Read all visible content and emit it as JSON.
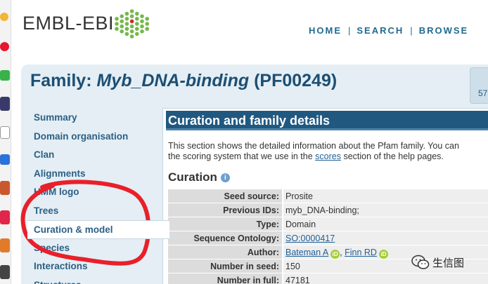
{
  "header": {
    "logo_text": "EMBL-EBI",
    "nav": [
      {
        "label": "HOME"
      },
      {
        "label": "SEARCH"
      },
      {
        "label": "BROWSE"
      }
    ],
    "separator": "|"
  },
  "page": {
    "title_prefix": "Family: ",
    "title_name": "Myb_DNA-binding",
    "title_suffix": " (PF00249)",
    "corner_number": "57"
  },
  "sidebar": {
    "items": [
      {
        "label": "Summary"
      },
      {
        "label": "Domain organisation"
      },
      {
        "label": "Clan"
      },
      {
        "label": "Alignments"
      },
      {
        "label": "HMM logo"
      },
      {
        "label": "Trees"
      },
      {
        "label": "Curation & model"
      },
      {
        "label": "Species"
      },
      {
        "label": "Interactions"
      },
      {
        "label": "Structures"
      }
    ],
    "active_index": 6
  },
  "content": {
    "heading": "Curation and family details",
    "intro_line1": "This section shows the detailed information about the Pfam family. You can",
    "intro_line2_a": "the scoring system that we use in the ",
    "intro_link": "scores",
    "intro_line2_b": " section of the help pages.",
    "section_title": "Curation",
    "info_icon": "i",
    "rows": [
      {
        "label": "Seed source:",
        "value": "Prosite"
      },
      {
        "label": "Previous IDs:",
        "value": "myb_DNA-binding;"
      },
      {
        "label": "Type:",
        "value": "Domain"
      },
      {
        "label": "Sequence Ontology:",
        "link": "SO:0000417"
      },
      {
        "label": "Author:",
        "author1": "Bateman A",
        "author_sep": ", ",
        "author2": "Finn RD",
        "orcid_glyph": "iD"
      },
      {
        "label": "Number in seed:",
        "value": "150"
      },
      {
        "label": "Number in full:",
        "value": "47181"
      }
    ]
  },
  "watermark": {
    "text": "生信图"
  },
  "colors": {
    "brand_blue": "#1d4e73",
    "section_header": "#205880",
    "link": "#1f5f95",
    "annotation_red": "#e8202a",
    "orcid_green": "#a6ce39"
  }
}
